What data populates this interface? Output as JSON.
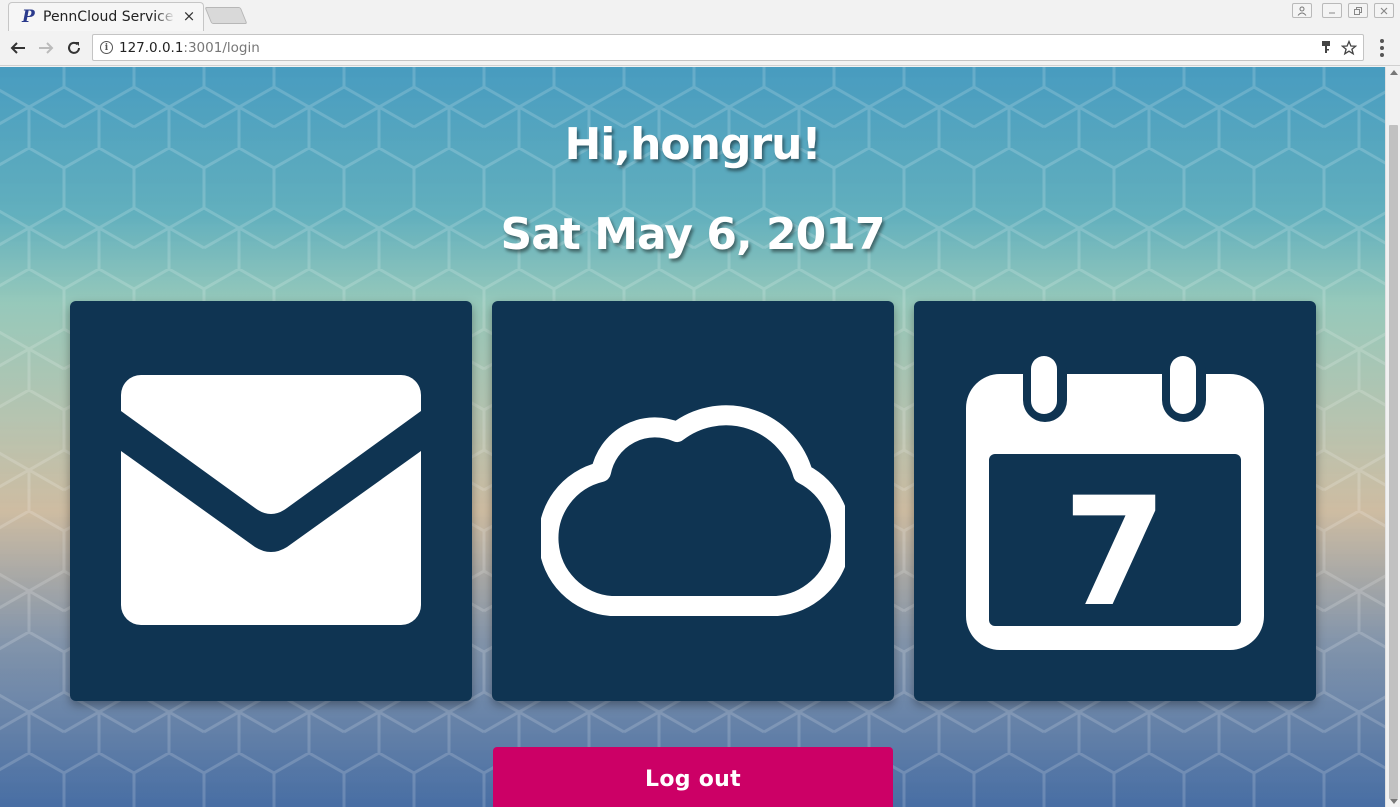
{
  "browser": {
    "tab_title": "PennCloud Service page",
    "tab_favicon": "P",
    "tab_close": "×",
    "url_host": "127.0.0.1",
    "url_path": ":3001/login",
    "info_glyph": "i"
  },
  "page": {
    "greeting": "Hi,hongru!",
    "date": "Sat May 6, 2017",
    "tiles": [
      {
        "name": "mail",
        "icon": "envelope-icon"
      },
      {
        "name": "storage",
        "icon": "cloud-icon"
      },
      {
        "name": "calendar",
        "icon": "calendar-icon",
        "day": "7"
      }
    ],
    "logout_label": "Log out"
  },
  "colors": {
    "tile_bg": "#0f3452",
    "logout_bg": "#cc0066",
    "text": "#ffffff"
  }
}
